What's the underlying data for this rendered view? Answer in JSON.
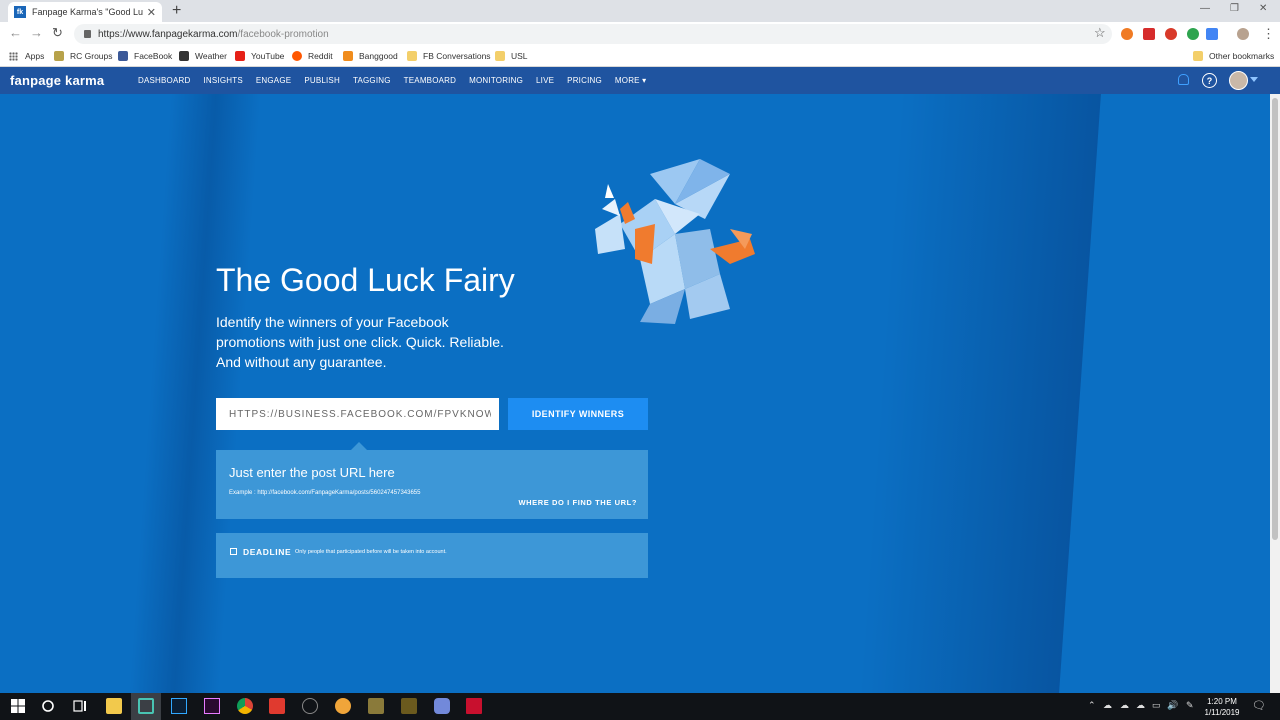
{
  "browser": {
    "tab_title": "Fanpage Karma's \"Good Luck Fai",
    "tab_favicon": "fk",
    "url_domain": "https://www.fanpagekarma.com",
    "url_path": "/facebook-promotion"
  },
  "bookmarks": [
    {
      "label": "Apps",
      "icon": "apps-icon",
      "color": "#666666"
    },
    {
      "label": "RC Groups",
      "icon": "rc-groups-icon",
      "color": "#b7a24a"
    },
    {
      "label": "FaceBook",
      "icon": "facebook-icon",
      "color": "#3b5998"
    },
    {
      "label": "Weather",
      "icon": "weather-icon",
      "color": "#333333"
    },
    {
      "label": "YouTube",
      "icon": "youtube-icon",
      "color": "#e62117"
    },
    {
      "label": "Reddit",
      "icon": "reddit-icon",
      "color": "#ff5700"
    },
    {
      "label": "Banggood",
      "icon": "banggood-icon",
      "color": "#f08c1c"
    },
    {
      "label": "FB Conversations",
      "icon": "folder-icon",
      "color": "#f3cf6a"
    },
    {
      "label": "USL",
      "icon": "folder-icon",
      "color": "#f3cf6a"
    }
  ],
  "other_bookmarks": "Other bookmarks",
  "site": {
    "logo": "fanpage karma",
    "nav": [
      "DASHBOARD",
      "INSIGHTS",
      "ENGAGE",
      "PUBLISH",
      "TAGGING",
      "TEAMBOARD",
      "MONITORING",
      "LIVE",
      "PRICING",
      "MORE ▾"
    ]
  },
  "hero": {
    "title": "The Good Luck Fairy",
    "lead": "Identify the winners of your Facebook promotions with just one click. Quick. Reliable. And without any guarantee.",
    "url_value": "HTTPS://BUSINESS.FACEBOOK.COM/FPVKNOWITALL/POSTS/",
    "button": "IDENTIFY WINNERS",
    "help_heading": "Just enter the post URL here",
    "help_example": "Example : http://facebook.com/FanpageKarma/posts/560247457343655",
    "help_link": "WHERE DO I FIND THE URL?",
    "deadline_label": "DEADLINE",
    "deadline_note": "Only people that participated before will be taken into account."
  },
  "taskbar": {
    "time": "1:20 PM",
    "date": "1/11/2019"
  },
  "colors": {
    "hero_bg": "#0b6fc3",
    "site_nav_bg": "#1f54a0",
    "button_bg": "#1d8df2",
    "card_bg": "#3d97d7"
  }
}
